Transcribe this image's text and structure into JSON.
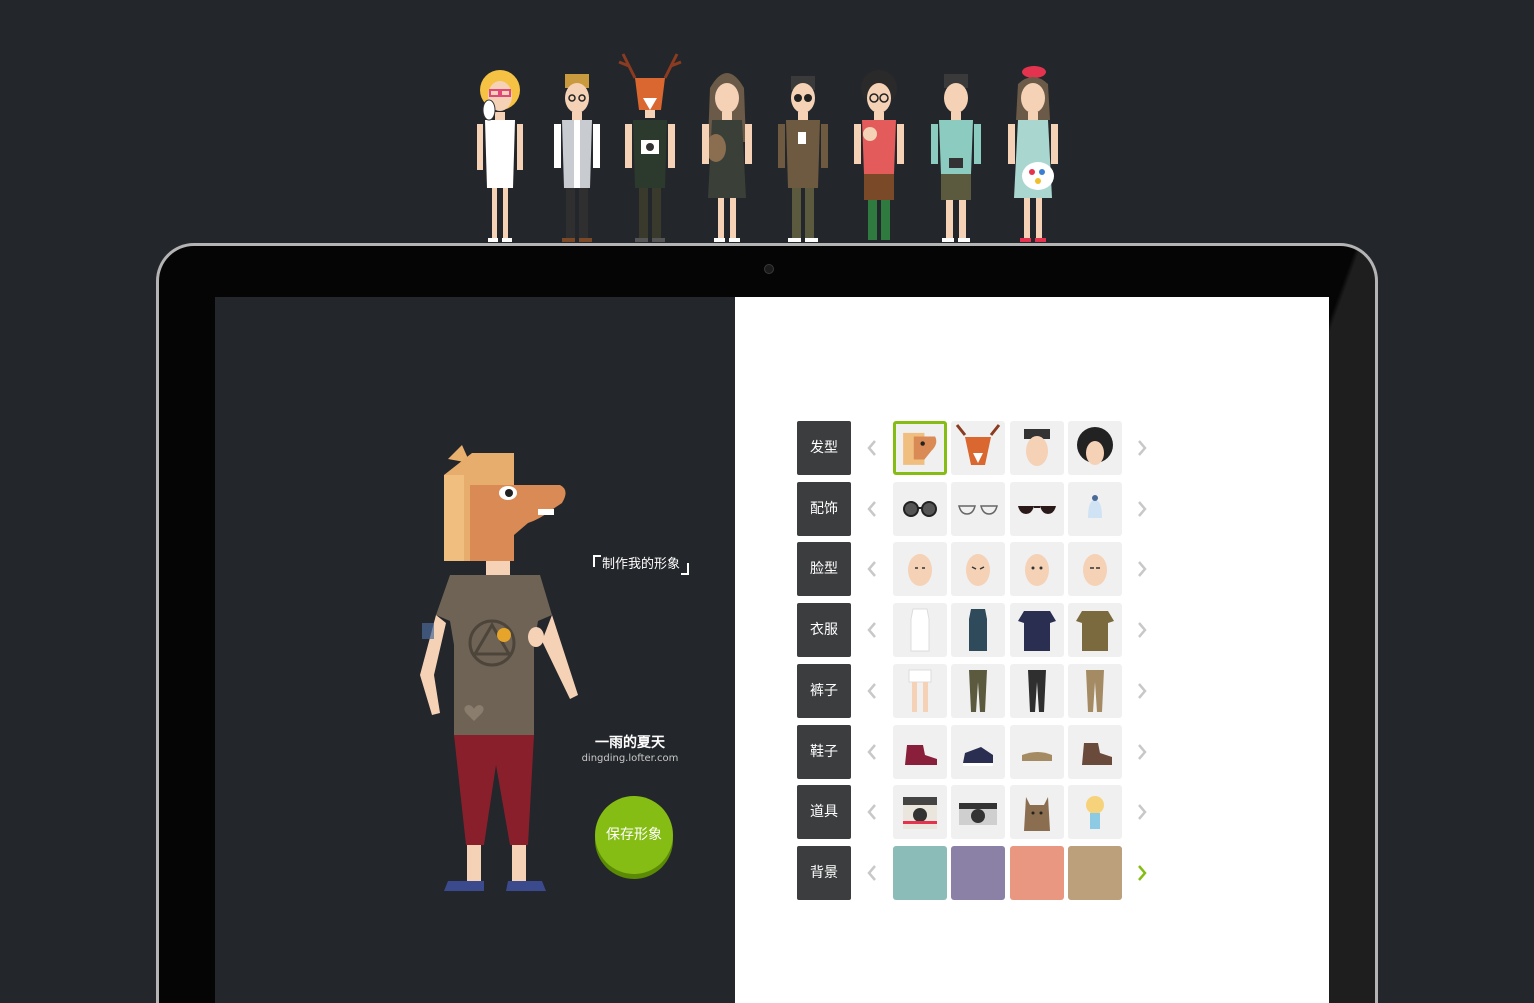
{
  "app": {
    "make_label": "制作我的形象",
    "user_name": "一雨的夏天",
    "user_url": "dingding.lofter.com",
    "save_label": "保存形象"
  },
  "top_characters": [
    "marilyn-figure",
    "gentleman-figure",
    "deer-head-figure",
    "cat-girl-figure",
    "coffee-guy-figure",
    "baby-carrier-figure",
    "camera-guy-figure",
    "painter-girl-figure"
  ],
  "categories": [
    {
      "label": "发型",
      "items": [
        "horse-head-icon",
        "deer-head-icon",
        "short-hair-icon",
        "curly-hair-icon"
      ]
    },
    {
      "label": "配饰",
      "items": [
        "round-glasses-icon",
        "thin-glasses-icon",
        "sunglasses-icon",
        "knit-hat-icon"
      ]
    },
    {
      "label": "脸型",
      "items": [
        "face-1-icon",
        "face-2-icon",
        "face-3-icon",
        "face-4-icon"
      ]
    },
    {
      "label": "衣服",
      "items": [
        "white-tank-icon",
        "navy-tank-icon",
        "navy-tee-icon",
        "brown-shirt-icon"
      ]
    },
    {
      "label": "裤子",
      "items": [
        "white-shorts-icon",
        "olive-pants-icon",
        "black-pants-icon",
        "khaki-pants-icon"
      ]
    },
    {
      "label": "鞋子",
      "items": [
        "red-boot-icon",
        "navy-sneaker-icon",
        "tan-loafer-icon",
        "brown-boot-icon"
      ]
    },
    {
      "label": "道具",
      "items": [
        "polaroid-camera-icon",
        "film-camera-icon",
        "cat-icon",
        "doll-icon"
      ]
    },
    {
      "label": "背景",
      "items": [
        "#8bbcb8",
        "#8b80a6",
        "#e99781",
        "#bca07c"
      ]
    }
  ],
  "colors": {
    "accent": "#86bd14",
    "dark_bg": "#23262a",
    "label_bg": "#3c3d3f"
  }
}
